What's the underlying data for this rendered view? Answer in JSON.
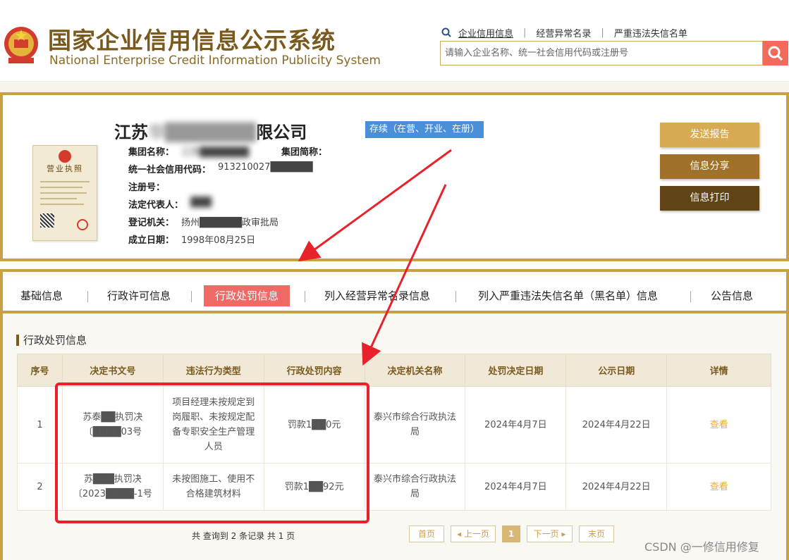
{
  "header": {
    "title_cn": "国家企业信用信息公示系统",
    "title_en": "National Enterprise Credit Information Publicity System",
    "links": [
      "企业信用信息",
      "经营异常名录",
      "严重违法失信名单"
    ],
    "search_placeholder": "请输入企业名称、统一社会信用代码或注册号"
  },
  "company": {
    "name_visible_start": "江苏",
    "name_blurred": "华███████",
    "name_visible_end": "限公司",
    "status": "存续（在营、开业、在册）",
    "license_label": "营业执照",
    "fields": [
      {
        "label": "集团名称：",
        "value": "江苏███████"
      },
      {
        "label": "集团简称：",
        "value": ""
      },
      {
        "label": "统一社会信用代码：",
        "value": "913210027██████"
      },
      {
        "label": "注册号：",
        "value": ""
      },
      {
        "label": "法定代表人：",
        "value": "███"
      },
      {
        "label": "登记机关：",
        "value": "扬州██████政审批局"
      },
      {
        "label": "成立日期：",
        "value": "1998年08月25日"
      }
    ],
    "buttons": {
      "send": "发送报告",
      "share": "信息分享",
      "print": "信息打印"
    }
  },
  "tabs": [
    {
      "label": "基础信息",
      "active": false
    },
    {
      "label": "行政许可信息",
      "active": false
    },
    {
      "label": "行政处罚信息",
      "active": true
    },
    {
      "label": "列入经营异常名录信息",
      "active": false
    },
    {
      "label": "列入严重违法失信名单（黑名单）信息",
      "active": false
    },
    {
      "label": "公告信息",
      "active": false
    }
  ],
  "section_title": "行政处罚信息",
  "table": {
    "headers": [
      "序号",
      "决定书文号",
      "违法行为类型",
      "行政处罚内容",
      "决定机关名称",
      "处罚决定日期",
      "公示日期",
      "详情"
    ],
    "rows": [
      {
        "no": "1",
        "doc_no": "苏泰██执罚决〔████03号",
        "type": "项目经理未按规定到岗履职、未按规定配备专职安全生产管理人员",
        "content": "罚款1██0元",
        "authority": "泰兴市综合行政执法局",
        "decision_date": "2024年4月7日",
        "publish_date": "2024年4月22日",
        "detail": "查看"
      },
      {
        "no": "2",
        "doc_no": "苏███执罚决〔2023████-1号",
        "type": "未按图施工、使用不合格建筑材料",
        "content": "罚款1██92元",
        "authority": "泰兴市综合行政执法局",
        "decision_date": "2024年4月7日",
        "publish_date": "2024年4月22日",
        "detail": "查看"
      }
    ]
  },
  "pagination": {
    "summary": "共 查询到 2 条记录 共 1 页",
    "first": "首页",
    "prev": "◂ 上一页",
    "current": "1",
    "next": "下一页 ▸",
    "last": "末页"
  },
  "watermark": "CSDN @一修信用修复",
  "colors": {
    "gold": "#c9a144",
    "brown": "#7a5a1c",
    "active_tab": "#ef6a64",
    "status_blue": "#4a90d9",
    "annotation_red": "#e8212b"
  }
}
